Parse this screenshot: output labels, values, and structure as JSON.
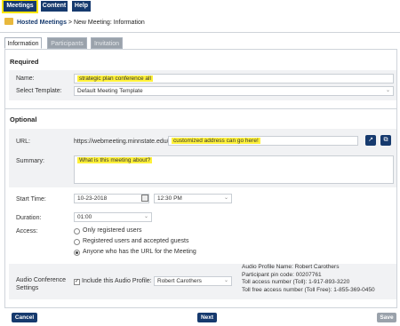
{
  "nav": {
    "meetings": "Meetings",
    "content": "Content",
    "help": "Help"
  },
  "breadcrumb": {
    "link": "Hosted Meetings",
    "separator": ">",
    "current": "New Meeting: Information"
  },
  "tabs": {
    "information": "Information",
    "participants": "Participants",
    "invitation": "Invitation"
  },
  "required": {
    "title": "Required",
    "name_label": "Name:",
    "name_value": "strategic plan conference all",
    "template_label": "Select Template:",
    "template_value": "Default Meeting Template"
  },
  "optional": {
    "title": "Optional",
    "url_label": "URL:",
    "url_prefix": "https://webmeeting.minnstate.edu/",
    "url_value": "customized address can go here!",
    "summary_label": "Summary:",
    "summary_value": "What is this meeting about?",
    "start_label": "Start Time:",
    "start_date": "10-23-2018",
    "start_time": "12:30 PM",
    "duration_label": "Duration:",
    "duration_value": "01:00",
    "access_label": "Access:",
    "access_options": [
      "Only registered users",
      "Registered users and accepted guests",
      "Anyone who has the URL for the Meeting"
    ],
    "audio_label_1": "Audio Conference",
    "audio_label_2": "Settings",
    "audio_check_label": "Include this Audio Profile:",
    "audio_profile_value": "Robert Carothers",
    "audio_info": [
      "Audio Profile Name: Robert Carothers",
      "Participant pin code: 00207761",
      "Toll access number (Toll): 1-917-893-3220",
      "Toll free access number (Toll Free): 1-855-369-0450"
    ]
  },
  "buttons": {
    "cancel": "Cancel",
    "next": "Next",
    "save": "Save"
  },
  "colors": {
    "nav": "#163a6e",
    "highlight": "#fff13a",
    "tab_inactive": "#9aa2ab"
  }
}
